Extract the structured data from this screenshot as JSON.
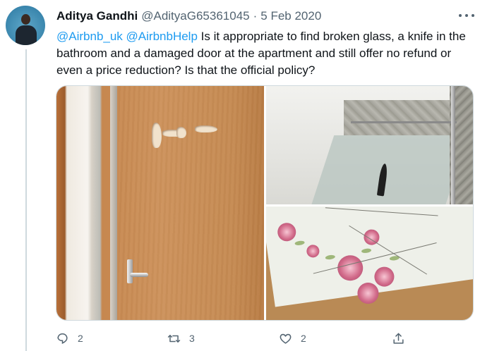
{
  "author": {
    "name": "Aditya Gandhi",
    "handle": "@AdityaG65361045",
    "separator": "·",
    "date": "5 Feb 2020"
  },
  "tweet": {
    "mention_1": "@Airbnb_uk",
    "mention_2": "@AirbnbHelp",
    "text": "Is it appropriate to find broken glass, a knife in the bathroom and a damaged door at the apartment and still offer no refund or even a price reduction? Is that the official policy?"
  },
  "actions": {
    "reply_count": "2",
    "retweet_count": "3",
    "like_count": "2"
  },
  "icons": {
    "more": "more-icon",
    "reply": "reply-icon",
    "retweet": "retweet-icon",
    "like": "like-icon",
    "share": "share-icon"
  },
  "colors": {
    "link": "#1d9bf0",
    "secondary_text": "#536471",
    "primary_text": "#0f1419",
    "border": "#cfd9de"
  }
}
